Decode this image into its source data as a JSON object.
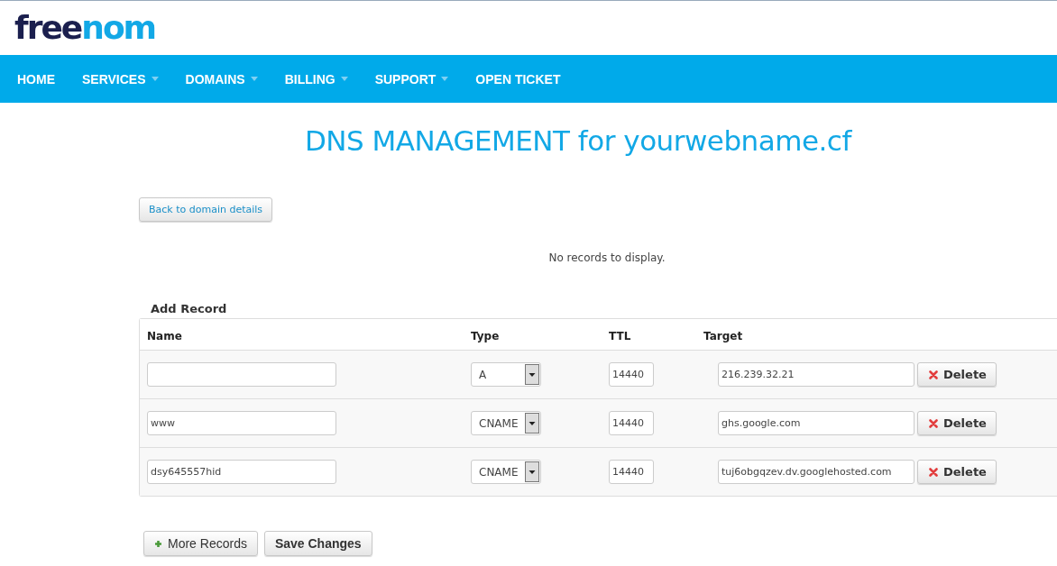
{
  "logo": {
    "parts": [
      "free",
      "nom"
    ]
  },
  "nav": [
    {
      "label": "HOME",
      "dropdown": false
    },
    {
      "label": "SERVICES",
      "dropdown": true
    },
    {
      "label": "DOMAINS",
      "dropdown": true
    },
    {
      "label": "BILLING",
      "dropdown": true
    },
    {
      "label": "SUPPORT",
      "dropdown": true
    },
    {
      "label": "OPEN TICKET",
      "dropdown": false
    }
  ],
  "title": "DNS MANAGEMENT for yourwebname.cf",
  "back_button": "Back to domain details",
  "empty_message": "No records to display.",
  "add_record": {
    "heading": "Add Record",
    "columns": [
      "Name",
      "Type",
      "TTL",
      "Target"
    ],
    "rows": [
      {
        "name": "",
        "type": "A",
        "ttl": "14440",
        "target": "216.239.32.21",
        "action": "Delete"
      },
      {
        "name": "www",
        "type": "CNAME",
        "ttl": "14440",
        "target": "ghs.google.com",
        "action": "Delete"
      },
      {
        "name": "dsy645557hid",
        "type": "CNAME",
        "ttl": "14440",
        "target": "tuj6obgqzev.dv.googlehosted.com",
        "action": "Delete"
      }
    ]
  },
  "buttons": [
    {
      "kind": "add",
      "label": "More Records"
    },
    {
      "kind": "save",
      "label": "Save Changes"
    }
  ]
}
